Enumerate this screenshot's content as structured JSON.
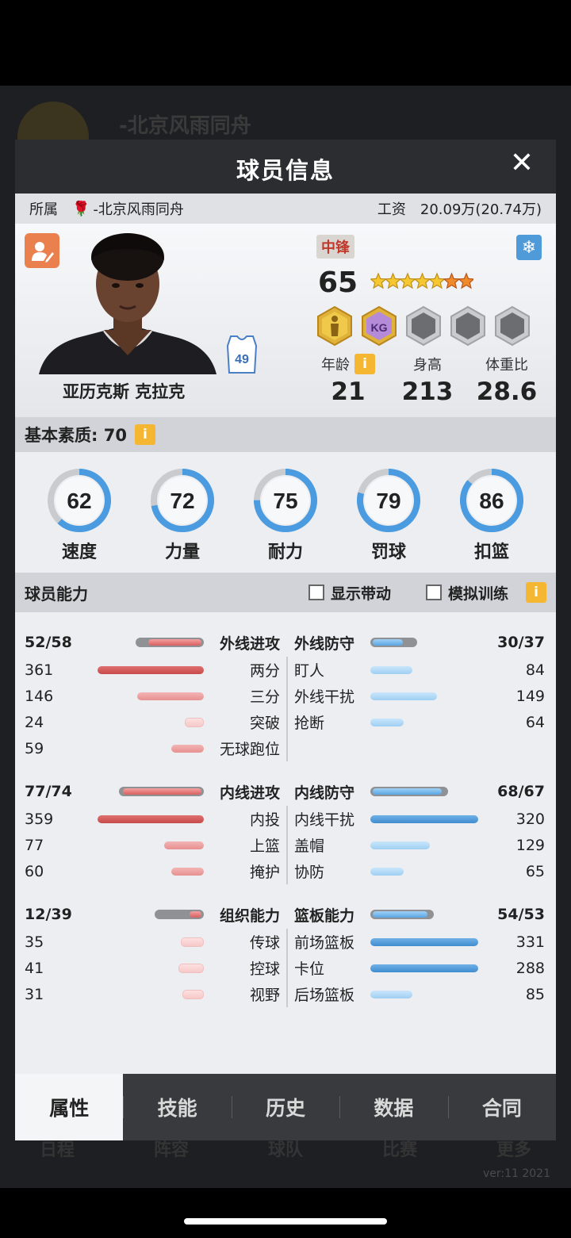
{
  "background": {
    "team_name": "-北京风雨同舟",
    "tabs": [
      "日程",
      "阵容",
      "球队",
      "比赛",
      "更多"
    ],
    "version": "ver:11  2021"
  },
  "modal": {
    "title": "球员信息",
    "close": "✕"
  },
  "info": {
    "affiliation_label": "所属",
    "team": "-北京风雨同舟",
    "salary_label": "工资",
    "salary": "20.09万(20.74万)"
  },
  "player": {
    "name": "亚历克斯 克拉克",
    "jersey_number": "49",
    "position": "中锋",
    "rating": "65",
    "stars": {
      "gold": 5,
      "orange": 2
    },
    "badges": [
      {
        "icon": "player-silhouette-badge",
        "color": "#e0b23a"
      },
      {
        "icon": "kg-badge",
        "color": "#b58ad8",
        "text": "KG"
      },
      {
        "icon": "empty-badge"
      },
      {
        "icon": "empty-badge"
      },
      {
        "icon": "empty-badge"
      }
    ],
    "stats": [
      {
        "label": "年龄",
        "value": "21",
        "info": "i"
      },
      {
        "label": "身高",
        "value": "213"
      },
      {
        "label": "体重比",
        "value": "28.6"
      }
    ]
  },
  "basic": {
    "label": "基本素质: 70",
    "info": "i"
  },
  "attributes": [
    {
      "name": "速度",
      "value": 62
    },
    {
      "name": "力量",
      "value": 72
    },
    {
      "name": "耐力",
      "value": 75
    },
    {
      "name": "罚球",
      "value": 79
    },
    {
      "name": "扣篮",
      "value": 86
    }
  ],
  "abilities": {
    "label": "球员能力",
    "show_dynamic": "显示带动",
    "simulate": "模拟训练",
    "info": "i",
    "sections": [
      {
        "left_head": {
          "label": "外线进攻",
          "value": "52/58",
          "fill": 0.52,
          "max": 0.58
        },
        "right_head": {
          "label": "外线防守",
          "value": "30/37",
          "fill": 0.3,
          "max": 0.37
        },
        "left_rows": [
          {
            "label": "两分",
            "value": "361",
            "fill": 0.86,
            "tone": "red"
          },
          {
            "label": "三分",
            "value": "146",
            "fill": 0.54,
            "tone": "redl"
          },
          {
            "label": "突破",
            "value": "24",
            "fill": 0.14,
            "tone": "redp"
          },
          {
            "label": "无球跑位",
            "value": "59",
            "fill": 0.26,
            "tone": "redl"
          }
        ],
        "right_rows": [
          {
            "label": "盯人",
            "value": "84",
            "fill": 0.34,
            "tone": "bluel"
          },
          {
            "label": "外线干扰",
            "value": "149",
            "fill": 0.54,
            "tone": "bluel"
          },
          {
            "label": "抢断",
            "value": "64",
            "fill": 0.27,
            "tone": "bluel"
          }
        ]
      },
      {
        "left_head": {
          "label": "内线进攻",
          "value": "77/74",
          "fill": 0.77,
          "max": 0.74
        },
        "right_head": {
          "label": "内线防守",
          "value": "68/67",
          "fill": 0.68,
          "max": 0.67
        },
        "left_rows": [
          {
            "label": "内投",
            "value": "359",
            "fill": 0.86,
            "tone": "red"
          },
          {
            "label": "上篮",
            "value": "77",
            "fill": 0.32,
            "tone": "redl"
          },
          {
            "label": "掩护",
            "value": "60",
            "fill": 0.26,
            "tone": "redl"
          }
        ],
        "right_rows": [
          {
            "label": "内线干扰",
            "value": "320",
            "fill": 0.87,
            "tone": "blue"
          },
          {
            "label": "盖帽",
            "value": "129",
            "fill": 0.48,
            "tone": "bluel"
          },
          {
            "label": "协防",
            "value": "65",
            "fill": 0.27,
            "tone": "bluel"
          }
        ]
      },
      {
        "left_head": {
          "label": "组织能力",
          "value": "12/39",
          "fill": 0.12,
          "max": 0.39
        },
        "right_head": {
          "label": "篮板能力",
          "value": "54/53",
          "fill": 0.54,
          "max": 0.53
        },
        "left_rows": [
          {
            "label": "传球",
            "value": "35",
            "fill": 0.17,
            "tone": "redp"
          },
          {
            "label": "控球",
            "value": "41",
            "fill": 0.19,
            "tone": "redp"
          },
          {
            "label": "视野",
            "value": "31",
            "fill": 0.16,
            "tone": "redp"
          }
        ],
        "right_rows": [
          {
            "label": "前场篮板",
            "value": "331",
            "fill": 0.87,
            "tone": "blue"
          },
          {
            "label": "卡位",
            "value": "288",
            "fill": 0.87,
            "tone": "blue"
          },
          {
            "label": "后场篮板",
            "value": "85",
            "fill": 0.34,
            "tone": "bluel"
          }
        ]
      }
    ]
  },
  "tabs": [
    {
      "label": "属性",
      "active": true
    },
    {
      "label": "技能"
    },
    {
      "label": "历史"
    },
    {
      "label": "数据"
    },
    {
      "label": "合同"
    }
  ],
  "colors": {
    "accent_red": "#c84a4a",
    "accent_blue": "#3f8ccf",
    "info_yellow": "#f5b731"
  }
}
